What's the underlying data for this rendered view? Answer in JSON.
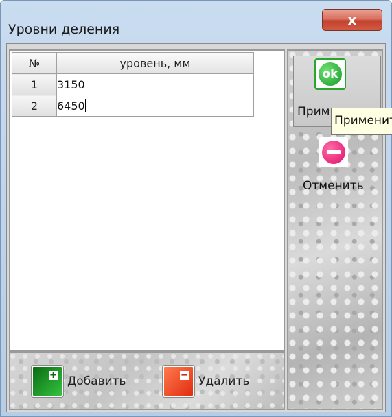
{
  "window": {
    "title": "Уровни деления",
    "close_symbol": "x"
  },
  "table": {
    "headers": [
      "№",
      "уровень, мм"
    ],
    "rows": [
      {
        "num": "1",
        "level": "3150"
      },
      {
        "num": "2",
        "level": "6450"
      }
    ]
  },
  "buttons": {
    "add_label": "Добавить",
    "delete_label": "Удалить",
    "apply_label": "Прим",
    "apply_tooltip": "Применить",
    "cancel_label": "Отменить",
    "ok_icon_text": "ok"
  },
  "icons": {
    "add": "plus-icon",
    "delete": "minus-icon",
    "apply": "ok-icon",
    "cancel": "cancel-icon",
    "close": "close-icon"
  },
  "colors": {
    "add_green": "#1a9a28",
    "delete_red": "#e8401c",
    "ok_green": "#2aa52e",
    "cancel_pink": "#e0106a",
    "tooltip_bg": "#ffffe1"
  }
}
